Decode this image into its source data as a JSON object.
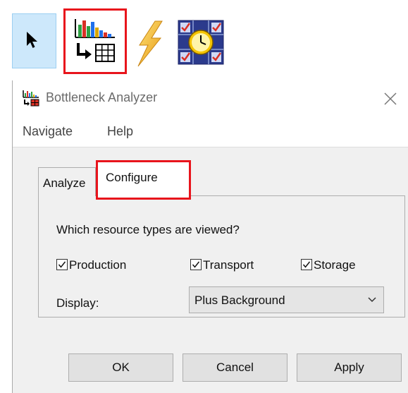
{
  "toolbar": {
    "tools": [
      {
        "name": "select-arrow-icon",
        "state": "active"
      },
      {
        "name": "bottleneck-analyzer-icon",
        "state": "highlighted"
      },
      {
        "name": "lightning-icon"
      },
      {
        "name": "schedule-clock-icon"
      }
    ]
  },
  "window": {
    "title": "Bottleneck Analyzer",
    "menu": [
      "Navigate",
      "Help"
    ],
    "tabs": [
      {
        "label": "Analyze",
        "active": false
      },
      {
        "label": "Configure",
        "active": true
      }
    ],
    "configure": {
      "question": "Which resource types are viewed?",
      "checkboxes": [
        {
          "label": "Production",
          "checked": true
        },
        {
          "label": "Transport",
          "checked": true
        },
        {
          "label": "Storage",
          "checked": true
        }
      ],
      "display_label": "Display:",
      "display_value": "Plus Background"
    },
    "buttons": {
      "ok": "OK",
      "cancel": "Cancel",
      "apply": "Apply"
    }
  },
  "colors": {
    "highlight_red": "#e8141c",
    "selected_tool_bg": "#cde8fb"
  }
}
